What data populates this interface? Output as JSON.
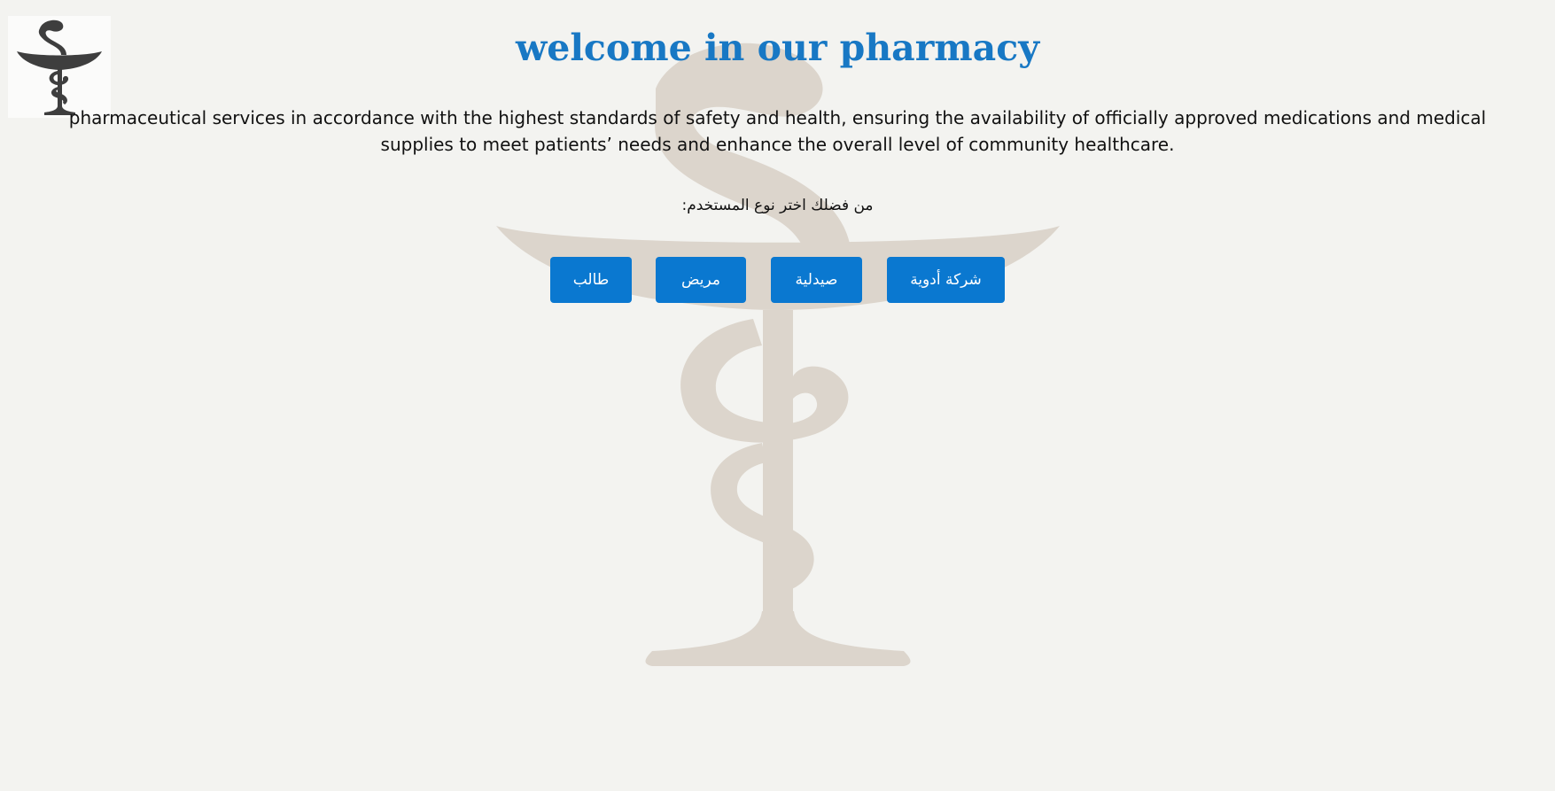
{
  "header": {
    "logo_icon": "bowl-of-hygieia-icon",
    "title": "welcome in our pharmacy",
    "title_color": "#1878c4"
  },
  "intro": {
    "text": "pharmaceutical services in accordance with the highest standards of safety and health, ensuring the availability of officially approved medications and medical supplies to meet patients’ needs and enhance the overall level of community healthcare."
  },
  "user_type": {
    "prompt": "من فضلك اختر نوع المستخدم:",
    "buttons": [
      {
        "label": "طالب"
      },
      {
        "label": "مريض"
      },
      {
        "label": "صيدلية"
      },
      {
        "label": "شركة أدوية"
      }
    ],
    "button_color": "#0a78d0"
  },
  "background": {
    "icon": "bowl-of-hygieia-watermark",
    "color": "#dcd5cc"
  }
}
